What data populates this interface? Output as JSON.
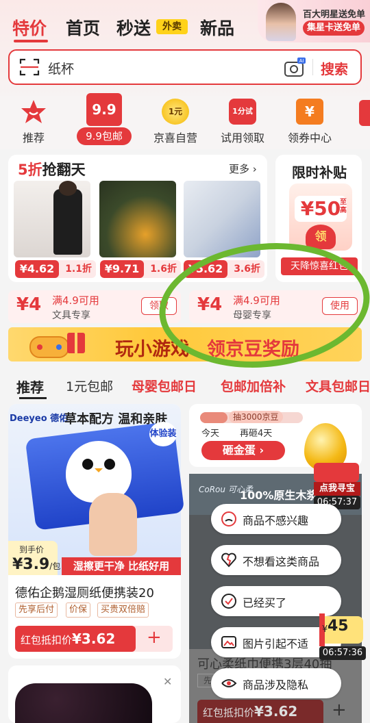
{
  "header": {
    "tabs": [
      {
        "label": "特价",
        "active": true
      },
      {
        "label": "首页"
      },
      {
        "label": "秒送"
      },
      {
        "label": "新品"
      }
    ],
    "waimai_badge": "外卖",
    "promo": {
      "line1": "百大明星送免单",
      "line2": "集星卡送免单"
    }
  },
  "search": {
    "value": "纸杯",
    "button": "搜索",
    "camera_badge": "AI"
  },
  "categories": [
    {
      "label": "推荐",
      "icon": "star-icon"
    },
    {
      "label": "9.9包邮",
      "badge": "9.9",
      "icon": "nine-nine-icon"
    },
    {
      "label": "京喜自营",
      "badge": "1元",
      "icon": "coin-icon"
    },
    {
      "label": "试用领取",
      "badge": "1分试",
      "icon": "trial-bag-icon"
    },
    {
      "label": "领券中心",
      "badge": "¥",
      "icon": "coupon-center-icon"
    }
  ],
  "flash": {
    "title_red": "5折",
    "title_rest": "抢翻天",
    "more": "更多 ›",
    "items": [
      {
        "price": "¥4.62",
        "discount": "1.1折",
        "image": "apron"
      },
      {
        "price": "¥9.71",
        "discount": "1.6折",
        "image": "pumpkin"
      },
      {
        "price": "¥5.62",
        "discount": "3.6折",
        "image": "paper-towels"
      }
    ]
  },
  "limit": {
    "title": "限时补贴",
    "amount": "¥50",
    "amount_suffix": "至高",
    "ling": "领",
    "button": "天降惊喜红包"
  },
  "coupons": [
    {
      "amount": "¥4",
      "condition": "满4.9可用",
      "scope": "文具专享",
      "button": "领取"
    },
    {
      "amount": "¥4",
      "condition": "满4.9可用",
      "scope": "母婴专享",
      "button": "使用"
    }
  ],
  "banner": {
    "part1": "玩小游戏",
    "part2": "领京豆奖励"
  },
  "feed_tabs": [
    {
      "label": "推荐",
      "style": "active"
    },
    {
      "label": "1元包邮",
      "style": "normal"
    },
    {
      "label": "母婴包邮日",
      "style": "red"
    },
    {
      "label": "包邮加倍补",
      "style": "red"
    },
    {
      "label": "文具包邮日",
      "style": "red"
    }
  ],
  "product_left": {
    "brand": "Deeyeo 德佑",
    "slogan": "草本配方 温和亲肤",
    "trial_badge": "体验装",
    "arrival_label": "到手价",
    "arrival_price": "¥3.9",
    "arrival_unit": "/包",
    "strip": "湿擦更干净 比纸好用",
    "title": "德佑企鹅湿厕纸便携装20",
    "tags": [
      "先享后付",
      "价保",
      "买贵双倍赔"
    ],
    "redbag_label": "红包抵扣价",
    "redbag_price": "¥3.62",
    "add": "+"
  },
  "egg": {
    "reward": "抽3000京豆",
    "today": "今天",
    "again": "再砸4天",
    "button": "砸金蛋 ›",
    "treasure": "点我寻宝",
    "timer": "06:57:37"
  },
  "product_right": {
    "brand": "CoRou 可心柔",
    "title": "100%原生木浆",
    "footer_title": "可心柔纸巾便携3层40抽",
    "footer_tag": "先",
    "redbag_label": "红包抵扣价",
    "redbag_price": "¥3.62",
    "add": "+"
  },
  "feedback_menu": [
    {
      "label": "商品不感兴趣",
      "icon": "meh-face-icon"
    },
    {
      "label": "不想看这类商品",
      "icon": "broken-heart-icon"
    },
    {
      "label": "已经买了",
      "icon": "check-circle-icon"
    },
    {
      "label": "图片引起不适",
      "icon": "image-icon"
    },
    {
      "label": "商品涉及隐私",
      "icon": "eye-icon"
    }
  ],
  "coin_float": {
    "value": "45",
    "currency": "¥",
    "timer": "06:57:36"
  },
  "colors": {
    "brand_red": "#e4393c",
    "annotation_green": "#6cb830"
  }
}
